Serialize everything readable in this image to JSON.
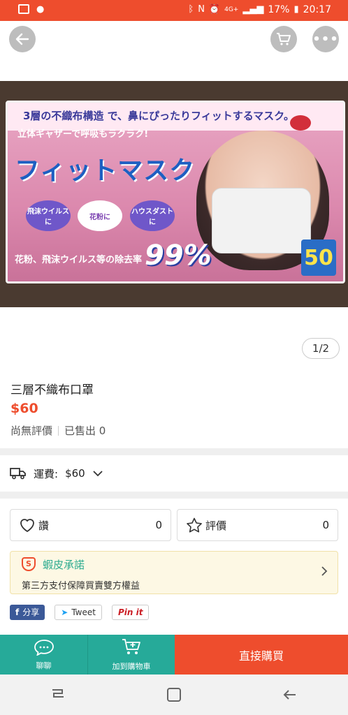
{
  "status_bar": {
    "battery_percent": "17%",
    "time": "20:17",
    "network": "4G+"
  },
  "product": {
    "image_counter": "1/2",
    "name": "三層不織布口罩",
    "price": "$60",
    "rating_text": "尚無評價",
    "sold_text": "已售出 0",
    "image": {
      "box_line1": "3層の不織布構造 で、鼻にぴったりフィットするマスク。",
      "box_line2": "立体ギャザーで呼吸もラクラク!",
      "box_title": "フィットマスク",
      "pill1": "飛沫ウイルスに",
      "pill2": "花粉に",
      "pill3": "ハウスダストに",
      "rate": "99%",
      "sub": "花粉、飛沫ウイルス等の除去率",
      "count": "50"
    }
  },
  "shipping": {
    "label": "運費:",
    "value": "$60"
  },
  "actions": {
    "like_label": "讚",
    "like_count": "0",
    "review_label": "評價",
    "review_count": "0"
  },
  "guarantee": {
    "title": "蝦皮承諾",
    "desc": "第三方支付保障買賣雙方權益"
  },
  "share": {
    "facebook": "分享",
    "twitter": "Tweet",
    "pinterest": "Pin it"
  },
  "bottom_bar": {
    "chat": "聊聊",
    "add_cart": "加到購物車",
    "buy_now": "直接購買"
  },
  "colors": {
    "brand": "#ee4d2d",
    "teal": "#26aa99"
  }
}
